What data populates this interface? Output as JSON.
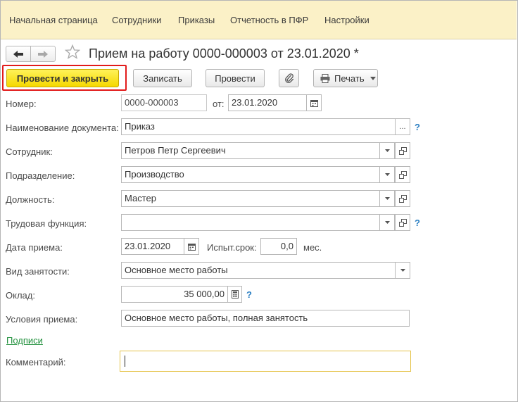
{
  "menu": {
    "items": [
      "Начальная страница",
      "Сотрудники",
      "Приказы",
      "Отчетность в ПФР",
      "Настройки"
    ]
  },
  "header": {
    "title": "Прием на работу 0000-000003 от 23.01.2020 *"
  },
  "toolbar": {
    "post_close_label": "Провести и закрыть",
    "save_label": "Записать",
    "post_label": "Провести",
    "print_label": "Печать"
  },
  "form": {
    "number_label": "Номер:",
    "number_value": "0000-000003",
    "date_from_label": "от:",
    "date_value": "23.01.2020",
    "doc_name_label": "Наименование документа:",
    "doc_name_value": "Приказ",
    "employee_label": "Сотрудник:",
    "employee_value": "Петров Петр Сергеевич",
    "department_label": "Подразделение:",
    "department_value": "Производство",
    "position_label": "Должность:",
    "position_value": "Мастер",
    "labor_function_label": "Трудовая функция:",
    "labor_function_value": "",
    "hire_date_label": "Дата приема:",
    "hire_date_value": "23.01.2020",
    "probation_label": "Испыт.срок:",
    "probation_value": "0,0",
    "probation_unit": "мес.",
    "employment_type_label": "Вид занятости:",
    "employment_type_value": "Основное место работы",
    "salary_label": "Оклад:",
    "salary_value": "35 000,00",
    "conditions_label": "Условия приема:",
    "conditions_value": "Основное место работы, полная занятость",
    "signatures_link": "Подписи",
    "comment_label": "Комментарий:",
    "comment_value": ""
  },
  "colors": {
    "menu_bg": "#fbf1c7",
    "primary_button": "#f5d800",
    "highlight_border": "#e21b1b",
    "link": "#1e8f3a",
    "help": "#2a7ec2"
  }
}
